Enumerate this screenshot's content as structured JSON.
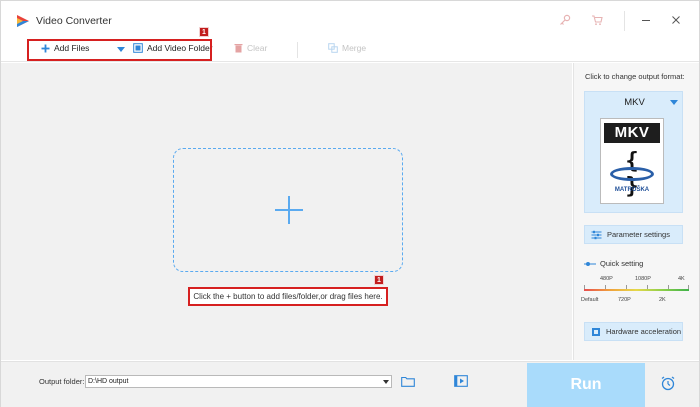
{
  "window": {
    "title": "Video Converter"
  },
  "toolbar": {
    "add_files": "Add Files",
    "add_video_folder": "Add Video Folder",
    "clear": "Clear",
    "merge": "Merge",
    "badge_number": "1"
  },
  "main": {
    "drop_hint": "Click the + button to add files/folder,or drag files here.",
    "hint_badge_number": "1"
  },
  "side_panel": {
    "change_format_label": "Click to change output format:",
    "format_name": "MKV",
    "format_logo_text": "MKV",
    "format_logo_subtext": "MATROŠKA",
    "parameter_settings": "Parameter settings",
    "quick_setting": "Quick setting",
    "scale_top": [
      "480P",
      "1080P",
      "4K"
    ],
    "scale_bottom": [
      "Default",
      "720P",
      "2K"
    ],
    "hardware_acceleration": "Hardware acceleration"
  },
  "bottom": {
    "output_folder_label": "Output folder:",
    "output_folder_value": "D:\\HD output",
    "run_label": "Run"
  },
  "colors": {
    "accent_blue": "#2f86d8",
    "highlight_red": "#d62020",
    "run_button": "#a9dbfb",
    "format_card": "#d9ecfb"
  }
}
